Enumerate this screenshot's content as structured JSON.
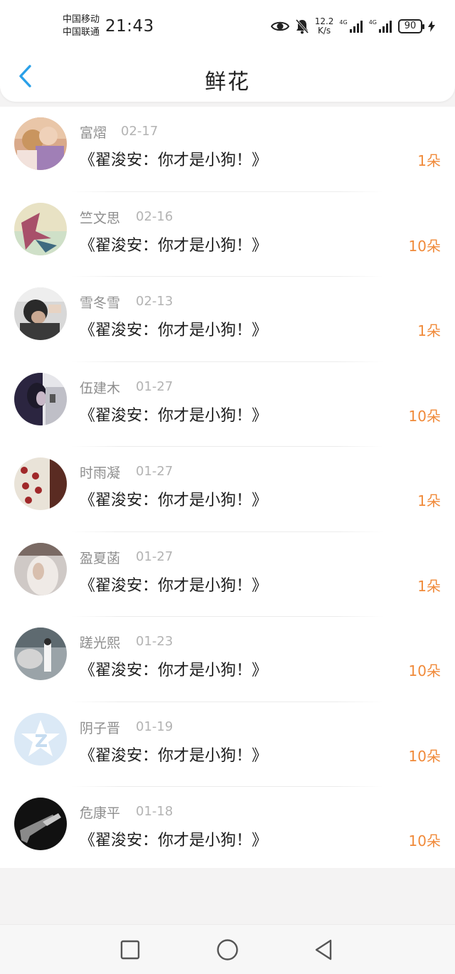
{
  "status_bar": {
    "carrier_1": "中国移动",
    "carrier_2": "中国联通",
    "time": "21:43",
    "net_speed_value": "12.2",
    "net_speed_unit": "K/s",
    "net_type_1": "4G",
    "net_type_2": "4G",
    "battery_level": "90"
  },
  "header": {
    "title": "鲜花"
  },
  "list": {
    "items": [
      {
        "name": "富熠",
        "date": "02-17",
        "text": "《翟浚安：你才是小狗！》",
        "count": "1朵"
      },
      {
        "name": "竺文思",
        "date": "02-16",
        "text": "《翟浚安：你才是小狗！》",
        "count": "10朵"
      },
      {
        "name": "雪冬雪",
        "date": "02-13",
        "text": "《翟浚安：你才是小狗！》",
        "count": "1朵"
      },
      {
        "name": "伍建木",
        "date": "01-27",
        "text": "《翟浚安：你才是小狗！》",
        "count": "10朵"
      },
      {
        "name": "时雨凝",
        "date": "01-27",
        "text": "《翟浚安：你才是小狗！》",
        "count": "1朵"
      },
      {
        "name": "盈夏菡",
        "date": "01-27",
        "text": "《翟浚安：你才是小狗！》",
        "count": "1朵"
      },
      {
        "name": "蹉光熙",
        "date": "01-23",
        "text": "《翟浚安：你才是小狗！》",
        "count": "10朵"
      },
      {
        "name": "阴子晋",
        "date": "01-19",
        "text": "《翟浚安：你才是小狗！》",
        "count": "10朵"
      },
      {
        "name": "危康平",
        "date": "01-18",
        "text": "《翟浚安：你才是小狗！》",
        "count": "10朵"
      }
    ]
  },
  "colors": {
    "accent_blue": "#2aa0e8",
    "count_orange": "#f08a3a",
    "name_gray": "#8e8e8e",
    "date_gray": "#b3b3b3"
  },
  "icons": {
    "back": "chevron-left-icon",
    "nav_recent": "square-icon",
    "nav_home": "circle-icon",
    "nav_back": "triangle-back-icon"
  }
}
